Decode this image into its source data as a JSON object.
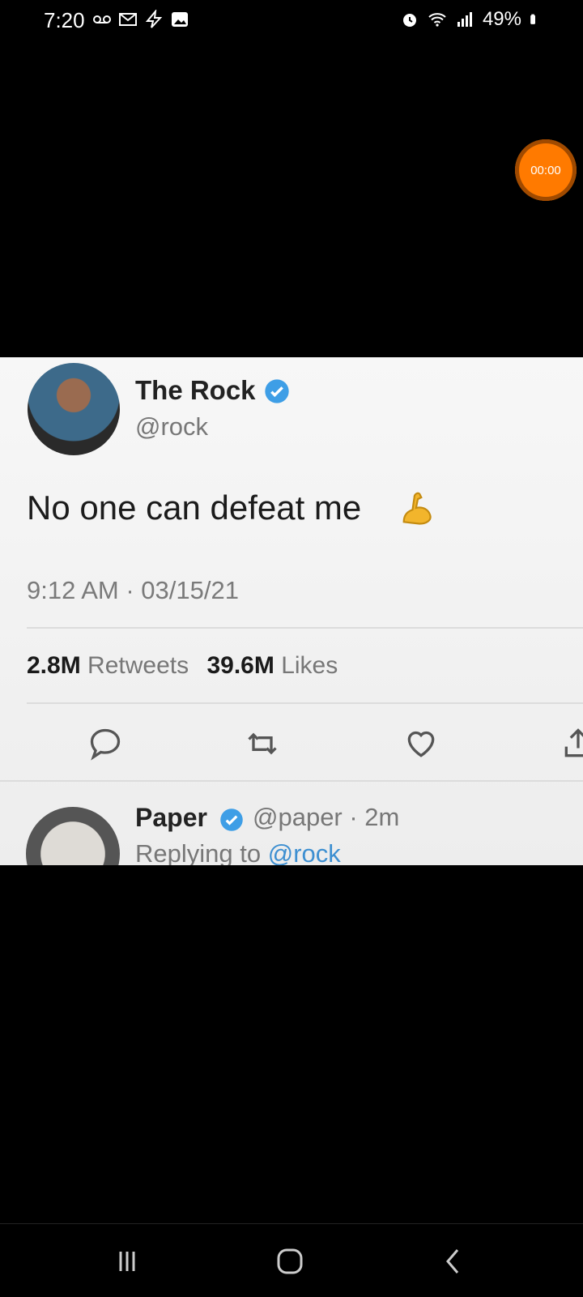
{
  "status": {
    "time": "7:20",
    "left_icons": [
      "voicemail-icon",
      "gmail-icon",
      "bolt-icon",
      "gallery-icon"
    ],
    "right_icons": [
      "alarm-icon",
      "wifi-icon",
      "signal-icon"
    ],
    "battery": "49%"
  },
  "timer": {
    "label": "00:00",
    "color": "#ff7a00"
  },
  "tweet": {
    "display_name": "The Rock",
    "handle": "@rock",
    "text": "No one can defeat me",
    "emoji": "flexed-biceps",
    "timestamp": "9:12 AM · 03/15/21",
    "retweets_count": "2.8M",
    "retweets_label": "Retweets",
    "likes_count": "39.6M",
    "likes_label": "Likes"
  },
  "reply": {
    "display_name": "Paper",
    "handle_time": "@paper · 2m",
    "replying_prefix": "Replying to",
    "replying_handle": "@rock"
  },
  "colors": {
    "verified": "#3e9ee6",
    "link": "#3d8fd1"
  },
  "nav": [
    "recent-apps",
    "home",
    "back"
  ]
}
